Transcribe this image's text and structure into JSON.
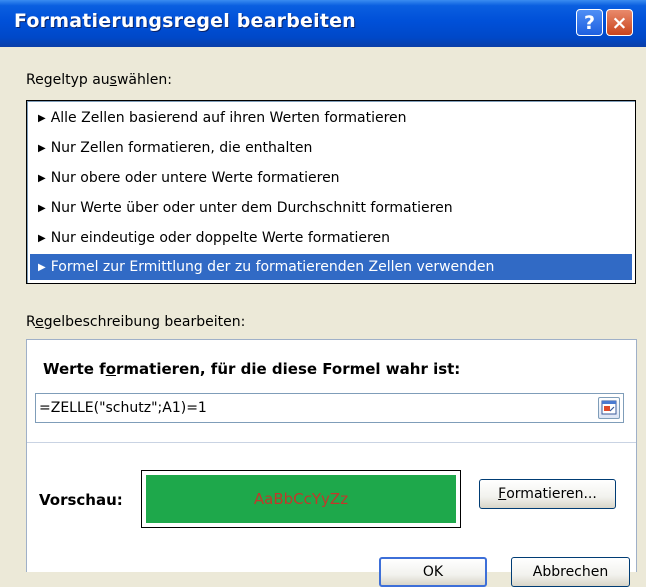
{
  "window": {
    "title": "Formatierungsregel bearbeiten",
    "help_glyph": "?",
    "close_glyph": "×"
  },
  "rule_type": {
    "label_pre": "Regeltyp au",
    "label_mn": "s",
    "label_post": "wählen:",
    "items": [
      {
        "label": "Alle Zellen basierend auf ihren Werten formatieren"
      },
      {
        "label": "Nur Zellen formatieren, die enthalten"
      },
      {
        "label": "Nur obere oder untere Werte formatieren"
      },
      {
        "label": "Nur Werte über oder unter dem Durchschnitt formatieren"
      },
      {
        "label": "Nur eindeutige oder doppelte Werte formatieren"
      },
      {
        "label": "Formel zur Ermittlung der zu formatierenden Zellen verwenden"
      }
    ],
    "selected_index": 5,
    "bullet": "▶"
  },
  "description": {
    "label_pre": "R",
    "label_mn": "e",
    "label_post": "gelbeschreibung bearbeiten:",
    "heading_pre": "Werte f",
    "heading_mn": "o",
    "heading_post": "rmatieren, für die diese Formel wahr ist:",
    "formula": "=ZELLE(\"schutz\";A1)=1",
    "preview_label": "Vorschau:",
    "preview_text": "AaBbCcYyZz",
    "preview_fill_color": "#1ea84b",
    "preview_text_color": "#c0392b",
    "format_button_mn": "F",
    "format_button_rest": "ormatieren..."
  },
  "buttons": {
    "ok": "OK",
    "cancel": "Abbrechen"
  }
}
